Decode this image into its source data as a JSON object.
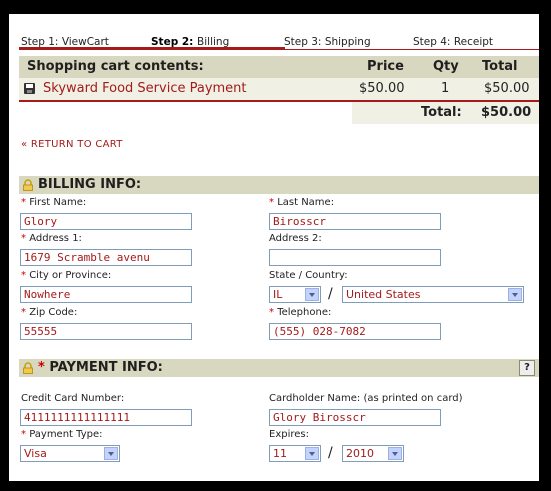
{
  "steps": [
    {
      "prefix": "Step 1: ",
      "label": "ViewCart"
    },
    {
      "prefix": "Step 2: ",
      "label": "Billing"
    },
    {
      "prefix": "Step 3: ",
      "label": "Shipping"
    },
    {
      "prefix": "Step 4: ",
      "label": "Receipt"
    }
  ],
  "cart": {
    "heading": "Shopping cart contents:",
    "col_price": "Price",
    "col_qty": "Qty",
    "col_total": "Total",
    "item": {
      "name": "Skyward Food Service Payment",
      "price": "$50.00",
      "qty": "1",
      "total": "$50.00"
    },
    "total_label": "Total:",
    "total_value": "$50.00"
  },
  "return_link": "« RETURN TO CART",
  "billing": {
    "heading": "BILLING INFO:",
    "first_name_label": "First Name:",
    "first_name": "Glory",
    "last_name_label": "Last Name:",
    "last_name": "Birosscr",
    "address1_label": "Address 1:",
    "address1": "1679 Scramble avenu",
    "address2_label": "Address 2:",
    "address2": "",
    "city_label": "City or Province:",
    "city": "Nowhere",
    "state_country_label": "State / Country:",
    "state": "IL",
    "country": "United States",
    "zip_label": "Zip Code:",
    "zip": "55555",
    "phone_label": "Telephone:",
    "phone": "(555) 028-7082"
  },
  "payment": {
    "heading": "PAYMENT INFO:",
    "help": "?",
    "card_number_label": "Credit Card Number:",
    "card_number": "4111111111111111",
    "cardholder_label": "Cardholder Name: (as printed on card)",
    "cardholder": "Glory Birosscr",
    "type_label": "Payment Type:",
    "type": "Visa",
    "expires_label": "Expires:",
    "exp_month": "11",
    "exp_year": "2010"
  },
  "colors": {
    "accent": "#a31b1b",
    "header_bg": "#d8d8c0",
    "row_bg": "#f0f0e4"
  }
}
